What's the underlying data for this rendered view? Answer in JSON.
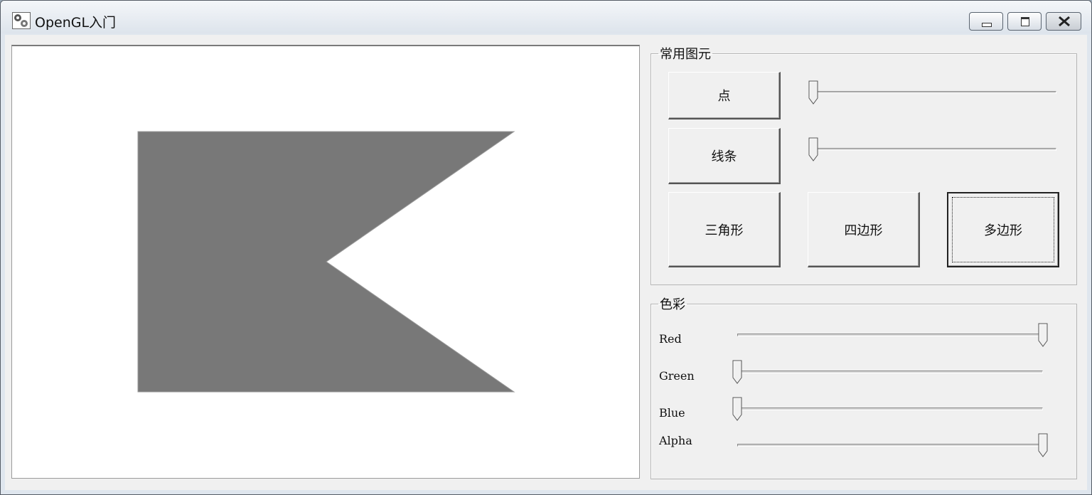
{
  "window": {
    "title": "OpenGL入门",
    "app_icon": "gears-icon"
  },
  "caption_buttons": {
    "minimize": "minimize-icon",
    "maximize": "maximize-icon",
    "close": "close-icon"
  },
  "canvas": {
    "shape_fill": "#787878",
    "background": "#ffffff"
  },
  "primitives_group": {
    "title": "常用图元",
    "point_button": "点",
    "line_button": "线条",
    "triangle_button": "三角形",
    "quad_button": "四边形",
    "polygon_button": "多边形",
    "point_size_slider": 0,
    "line_width_slider": 0
  },
  "color_group": {
    "title": "色彩",
    "red_label": "Red",
    "green_label": "Green",
    "blue_label": "Blue",
    "alpha_label": "Alpha",
    "red_value": 1.0,
    "green_value": 0.0,
    "blue_value": 0.0,
    "alpha_value": 1.0
  }
}
